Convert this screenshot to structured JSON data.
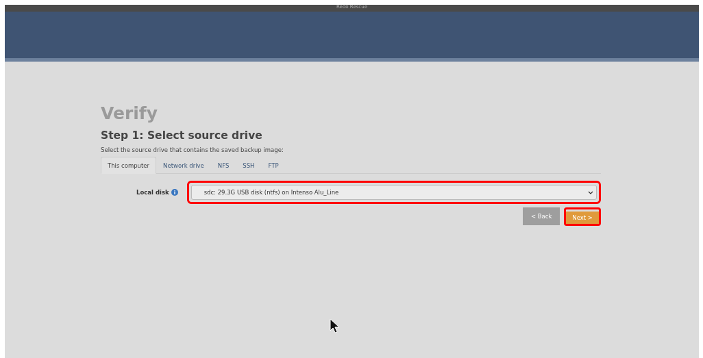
{
  "window": {
    "title": "Redo Rescue"
  },
  "page": {
    "title": "Verify",
    "step_title": "Step 1: Select source drive",
    "description": "Select the source drive that contains the saved backup image:"
  },
  "tabs": [
    {
      "label": "This computer",
      "selected": true
    },
    {
      "label": "Network drive",
      "selected": false
    },
    {
      "label": "NFS",
      "selected": false
    },
    {
      "label": "SSH",
      "selected": false
    },
    {
      "label": "FTP",
      "selected": false
    }
  ],
  "local_disk": {
    "label": "Local disk",
    "value": "sdc: 29.3G USB disk (ntfs) on Intenso Alu_Line",
    "highlighted": true
  },
  "buttons": [
    {
      "label": "< Back",
      "kind": "back",
      "highlighted": false
    },
    {
      "label": "Next >",
      "kind": "next",
      "highlighted": true
    }
  ]
}
